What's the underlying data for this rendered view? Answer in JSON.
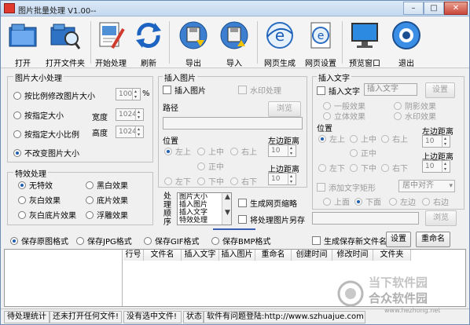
{
  "window": {
    "title": "图片批量处理 V1.00--",
    "min": "–",
    "max": "□",
    "close": "✕"
  },
  "toolbar": [
    {
      "label": "打开",
      "icon": "open-folder-icon"
    },
    {
      "label": "打开文件夹",
      "icon": "folder-search-icon"
    },
    {
      "label": "开始处理",
      "icon": "start-process-icon"
    },
    {
      "label": "刷新",
      "icon": "refresh-icon"
    },
    {
      "label": "导出",
      "icon": "export-disk-icon"
    },
    {
      "label": "导入",
      "icon": "import-disk-icon"
    },
    {
      "label": "网页生成",
      "icon": "web-generate-icon"
    },
    {
      "label": "网页设置",
      "icon": "web-settings-icon"
    },
    {
      "label": "预览窗口",
      "icon": "preview-monitor-icon"
    },
    {
      "label": "退出",
      "icon": "exit-icon"
    }
  ],
  "size_group": {
    "title": "图片大小处理",
    "opt_ratio": "按比例修改图片大小",
    "ratio_value": "100",
    "percent": "%",
    "opt_exact": "按指定大小",
    "width_label": "宽度",
    "width_value": "1024",
    "opt_exact_ratio": "按指定大小比例",
    "height_label": "高度",
    "height_value": "1024",
    "opt_keep": "不改变图片大小"
  },
  "effect_group": {
    "title": "特效处理",
    "items": [
      "无特效",
      "黑白效果",
      "灰白效果",
      "底片效果",
      "灰白底片效果",
      "浮雕效果"
    ]
  },
  "insert_image": {
    "title": "插入图片",
    "chk_insert": "插入图片",
    "chk_watermark": "水印处理",
    "path_label": "路径",
    "browse": "浏览",
    "pos_label": "位置",
    "positions": [
      "左上",
      "上中",
      "右上",
      "正中",
      "左下",
      "下中",
      "右下"
    ],
    "left_margin_label": "左边距离",
    "left_margin": "10",
    "top_margin_label": "上边距离",
    "top_margin": "10"
  },
  "insert_text": {
    "title": "插入文字",
    "chk_insert": "插入文字",
    "placeholder": "插入文字",
    "setting": "设置",
    "effects": [
      "一般效果",
      "阴影效果",
      "立体效果",
      "水印效果"
    ],
    "pos_label": "位置",
    "positions": [
      "左上",
      "上中",
      "右上",
      "正中",
      "左下",
      "下中",
      "右下"
    ],
    "left_margin_label": "左边距离",
    "left_margin": "10",
    "top_margin_label": "上边距离",
    "top_margin": "10",
    "chk_rect": "添加文字矩形",
    "align_value": "居中对齐",
    "rect_positions": [
      "上面",
      "下面",
      "左边",
      "右边"
    ]
  },
  "order": {
    "label": "处理顺序",
    "items": [
      "图片大小",
      "插入图片",
      "插入文字",
      "特效处理"
    ]
  },
  "options": {
    "gen_thumb": "生成网页缩略",
    "save_as": "将处理图片另存",
    "browse": "浏览",
    "format_png": "保存原图格式",
    "format_jpg": "保存JPG格式",
    "format_gif": "保存GIF格式",
    "format_bmp": "保存BMP格式",
    "gen_filename": "生成保存新文件名",
    "setting": "设置",
    "rename": "重命名"
  },
  "grid": {
    "columns": [
      "行号",
      "文件名",
      "插入文字",
      "插入图片",
      "重命名",
      "创建时间",
      "修改时间",
      "文件夹"
    ]
  },
  "status": {
    "stats_label": "待处理统计",
    "no_file": "还未打开任何文件!",
    "no_select": "没有选中文件!",
    "state_label": "状态",
    "message": "软件有问题登陆:http://www.szhuajue.com"
  },
  "watermark": {
    "line1": "当下软件园",
    "line2": "合众软件园",
    "url": "www.hezhong.net"
  }
}
